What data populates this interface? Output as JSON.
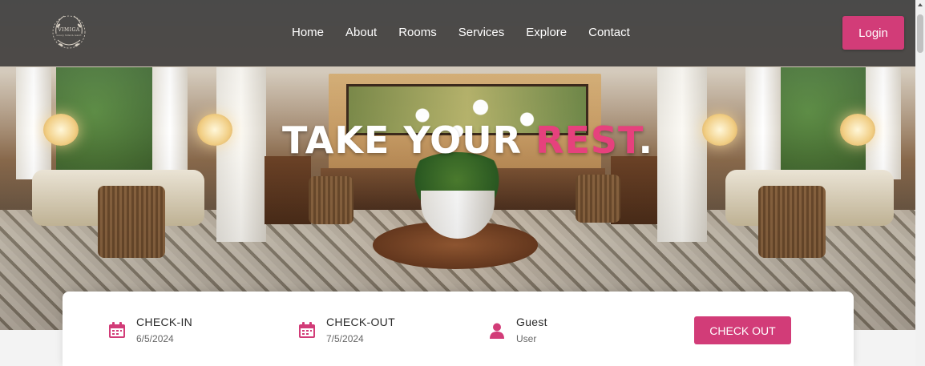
{
  "brand": {
    "name": "VIMIGA",
    "tagline": "luxury hotel & resort"
  },
  "nav": {
    "items": [
      "Home",
      "About",
      "Rooms",
      "Services",
      "Explore",
      "Contact"
    ]
  },
  "login_label": "Login",
  "hero": {
    "headline_main": "TAKE YOUR ",
    "headline_accent": "REST",
    "headline_end": "."
  },
  "booking": {
    "check_in": {
      "label": "CHECK-IN",
      "value": "6/5/2024",
      "icon": "calendar-icon"
    },
    "check_out": {
      "label": "CHECK-OUT",
      "value": "7/5/2024",
      "icon": "calendar-icon"
    },
    "guest": {
      "label": "Guest",
      "value": "User",
      "icon": "user-icon"
    },
    "button_label": "CHECK OUT"
  },
  "colors": {
    "accent": "#d23c78",
    "nav_bg": "#282626"
  }
}
